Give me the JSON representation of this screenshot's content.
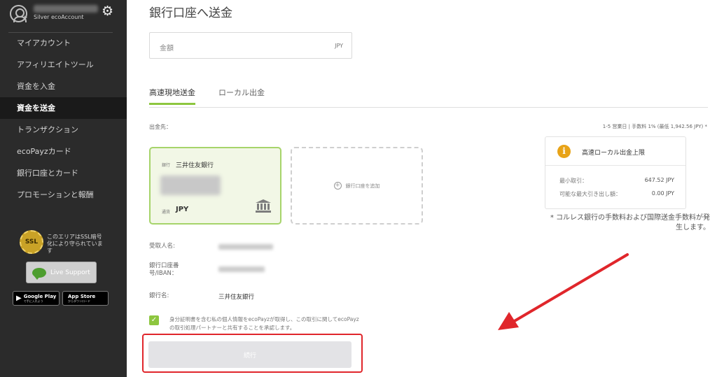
{
  "sidebar": {
    "account_type": "Silver ecoAccount",
    "items": [
      {
        "label": "マイアカウント",
        "active": false
      },
      {
        "label": "アフィリエイトツール",
        "active": false
      },
      {
        "label": "資金を入金",
        "active": false
      },
      {
        "label": "資金を送金",
        "active": true
      },
      {
        "label": "トランザクション",
        "active": false
      },
      {
        "label": "ecoPayzカード",
        "active": false
      },
      {
        "label": "銀行口座とカード",
        "active": false
      },
      {
        "label": "プロモーションと報酬",
        "active": false
      }
    ],
    "ssl_badge": "SSL",
    "ssl_text": "このエリアはSSL暗号化により守られています",
    "live_support": "Live Support",
    "google_play": {
      "name": "Google Play",
      "sub": "で手に入れよう"
    },
    "app_store": {
      "name": "App Store",
      "sub": "からダウンロード"
    }
  },
  "main": {
    "title": "銀行口座へ送金",
    "amount": {
      "placeholder": "金額",
      "currency": "JPY"
    },
    "tabs": [
      {
        "label": "高速現地送金",
        "active": true
      },
      {
        "label": "ローカル出金",
        "active": false
      }
    ],
    "destination_label": "出金先：",
    "fee_info": "1-5 営業日 | 手数料 1% (最低 1,942.56 JPY) *",
    "bank_card": {
      "kind_label": "銀行",
      "bank_name": "三井住友銀行",
      "currency_label": "通貨",
      "currency": "JPY"
    },
    "add_bank_label": "銀行口座を追加",
    "limits": {
      "title": "高速ローカル出金上限",
      "min_label": "最小取引：",
      "min_value": "647.52 JPY",
      "max_label": "可能な最大引き出し額：",
      "max_value": "0.00 JPY"
    },
    "fee_note": "* コルレス銀行の手数料および国際送金手数料が発生します。",
    "recipient": {
      "name_label": "受取人名:",
      "account_label": "銀行口座番号/IBAN：",
      "bank_label": "銀行名:",
      "bank_value": "三井住友銀行"
    },
    "consent_text": "身分証明書を含む私の個人情報をecoPayzが取得し、この取引に関してecoPayzの取引処理パートナーと共有することを承認します。",
    "continue_label": "続行"
  },
  "colors": {
    "accent_green": "#8dc63f",
    "annotation_red": "#e0262b",
    "info_orange": "#e8a317",
    "sidebar_bg": "#2b2b2b"
  }
}
